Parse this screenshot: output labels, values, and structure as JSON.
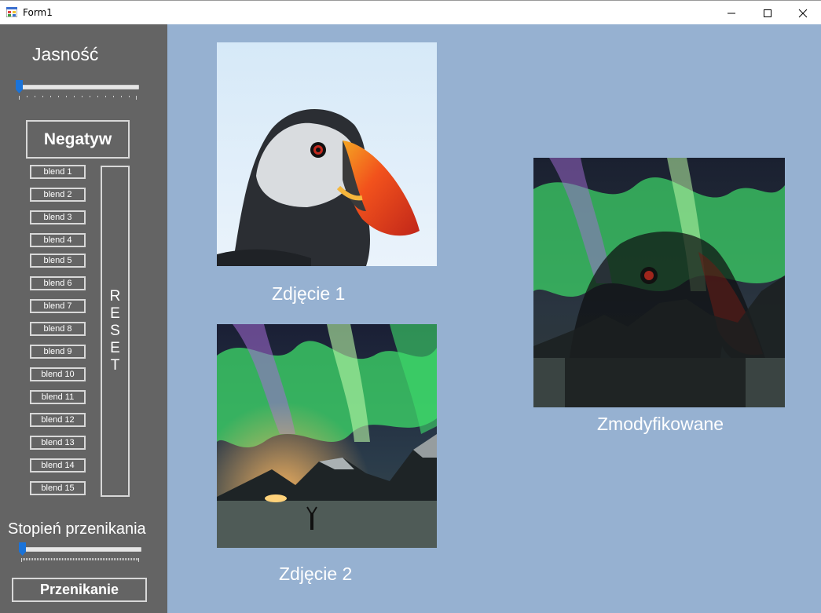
{
  "window": {
    "title": "Form1"
  },
  "sidebar": {
    "brightness_label": "Jasność",
    "negative_button": "Negatyw",
    "blend_buttons": [
      "blend 1",
      "blend 2",
      "blend 3",
      "blend 4",
      "blend 5",
      "blend 6",
      "blend 7",
      "blend 8",
      "blend 9",
      "blend 10",
      "blend 11",
      "blend 12",
      "blend 13",
      "blend 14",
      "blend 15"
    ],
    "reset_button": [
      "R",
      "E",
      "S",
      "E",
      "T"
    ],
    "blend_degree_label": "Stopień przenikania",
    "blend_action_button": "Przenikanie"
  },
  "sliders": {
    "brightness_value_fraction": 0.0,
    "blend_degree_value_fraction": 0.0
  },
  "images": {
    "image1_caption": "Zdjęcie 1",
    "image2_caption": "Zdjęcie 2",
    "result_caption": "Zmodyfikowane"
  },
  "colors": {
    "sidebar_bg": "#646464",
    "main_bg": "#96b1d1",
    "slider_thumb": "#1a73d9"
  }
}
